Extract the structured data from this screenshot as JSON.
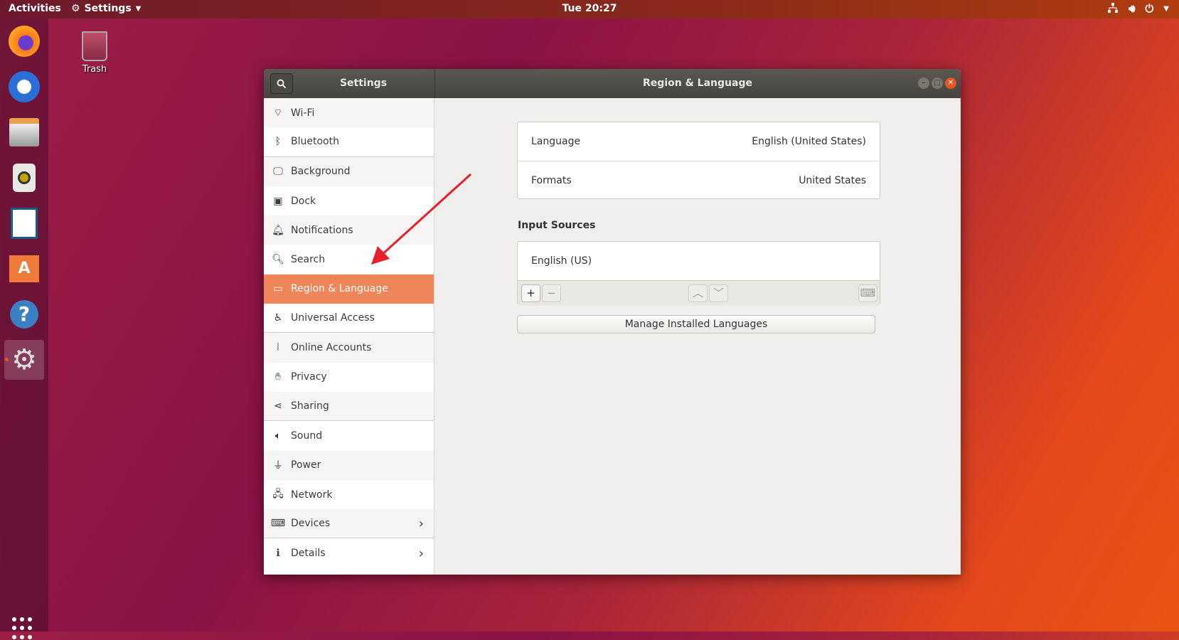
{
  "topbar": {
    "activities": "Activities",
    "app_menu": "Settings",
    "clock": "Tue 20:27",
    "tray": [
      "network-icon",
      "volume-icon",
      "power-icon"
    ]
  },
  "desktop": {
    "trash_label": "Trash"
  },
  "dock": {
    "apps": [
      "firefox",
      "thunderbird",
      "files",
      "rhythmbox",
      "libreoffice-writer",
      "ubuntu-software",
      "help",
      "settings"
    ],
    "active": "settings"
  },
  "window": {
    "sidebar_title": "Settings",
    "title": "Region & Language"
  },
  "sidebar": {
    "items": [
      {
        "label": "Wi-Fi",
        "icon": "wifi-icon"
      },
      {
        "label": "Bluetooth",
        "icon": "bluetooth-icon"
      },
      {
        "label": "Background",
        "icon": "background-icon"
      },
      {
        "label": "Dock",
        "icon": "dock-icon"
      },
      {
        "label": "Notifications",
        "icon": "bell-icon"
      },
      {
        "label": "Search",
        "icon": "search-icon"
      },
      {
        "label": "Region & Language",
        "icon": "region-icon",
        "selected": true
      },
      {
        "label": "Universal Access",
        "icon": "accessibility-icon"
      },
      {
        "label": "Online Accounts",
        "icon": "online-accounts-icon"
      },
      {
        "label": "Privacy",
        "icon": "hand-icon"
      },
      {
        "label": "Sharing",
        "icon": "share-icon"
      },
      {
        "label": "Sound",
        "icon": "speaker-icon"
      },
      {
        "label": "Power",
        "icon": "power-plug-icon"
      },
      {
        "label": "Network",
        "icon": "network-icon"
      },
      {
        "label": "Devices",
        "icon": "devices-icon"
      },
      {
        "label": "Details",
        "icon": "info-icon"
      }
    ]
  },
  "content": {
    "language_label": "Language",
    "language_value": "English (United States)",
    "formats_label": "Formats",
    "formats_value": "United States",
    "input_sources_title": "Input Sources",
    "input_sources": [
      "English (US)"
    ],
    "manage_button": "Manage Installed Languages"
  },
  "colors": {
    "accent": "#e95420",
    "selected_row": "#f0855a",
    "annotation_arrow": "#e8202a"
  }
}
